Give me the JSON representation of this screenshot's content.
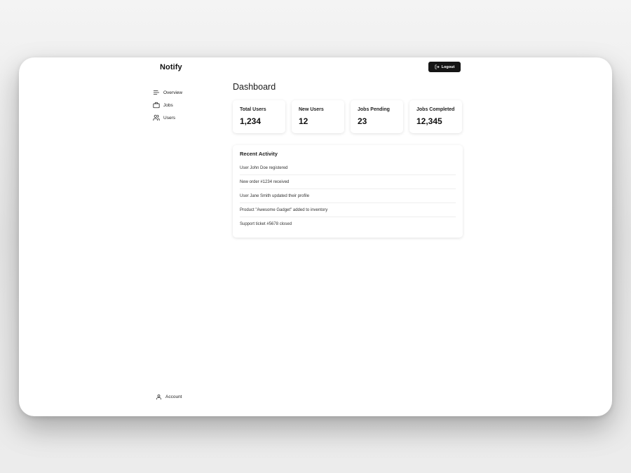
{
  "app": {
    "name": "Notify"
  },
  "header": {
    "logout_label": "Logout"
  },
  "sidebar": {
    "items": [
      {
        "label": "Overview",
        "icon": "menu-lines-icon"
      },
      {
        "label": "Jobs",
        "icon": "briefcase-icon"
      },
      {
        "label": "Users",
        "icon": "users-icon"
      }
    ],
    "account_label": "Account"
  },
  "main": {
    "title": "Dashboard",
    "stats": [
      {
        "label": "Total Users",
        "value": "1,234"
      },
      {
        "label": "New Users",
        "value": "12"
      },
      {
        "label": "Jobs Pending",
        "value": "23"
      },
      {
        "label": "Jobs Completed",
        "value": "12,345"
      }
    ],
    "activity": {
      "title": "Recent Activity",
      "items": [
        "User John Doe registered",
        "New order #1234 received",
        "User Jane Smith updated their profile",
        "Product \"Awesome Gadget\" added to inventory",
        "Support ticket #5678 closed"
      ]
    }
  },
  "colors": {
    "button_bg": "#151515",
    "card_bg": "#ffffff",
    "window_bg": "#ffffff"
  }
}
